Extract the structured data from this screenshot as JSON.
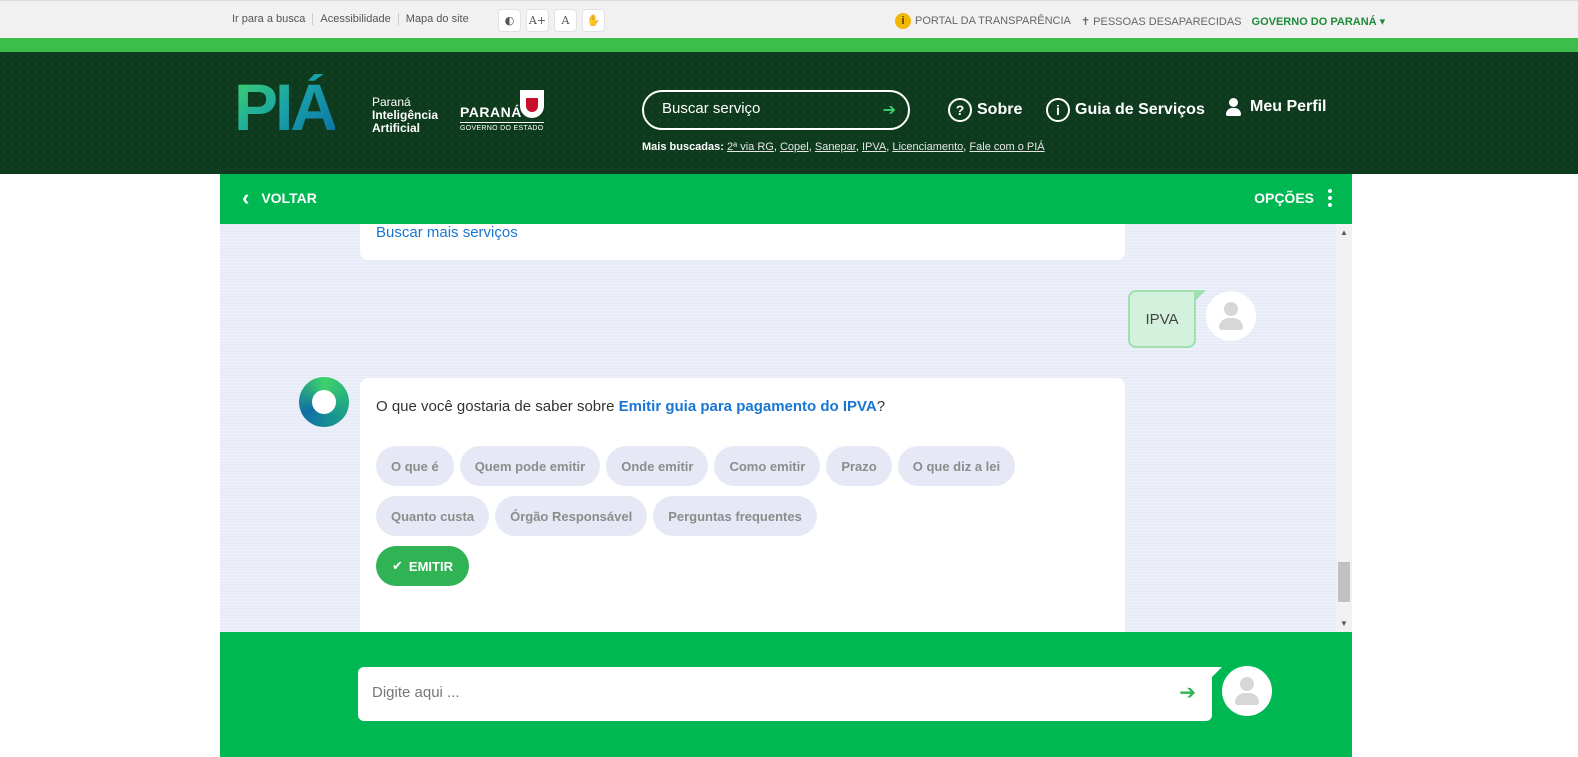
{
  "topbar": {
    "links": [
      "Ir para a busca",
      "Acessibilidade",
      "Mapa do site"
    ],
    "a11y_buttons": [
      "◐",
      "A+",
      "A",
      "✋"
    ],
    "portal": "PORTAL DA TRANSPARÊNCIA",
    "pessoas": "PESSOAS DESAPARECIDAS",
    "governo": "GOVERNO DO PARANÁ"
  },
  "header": {
    "logo": "PIÁ",
    "tagline": [
      "Paraná",
      "Inteligência",
      "Artificial"
    ],
    "state": "PARANÁ",
    "state_sub": "GOVERNO DO ESTADO",
    "search_placeholder": "Buscar serviço",
    "mais_label": "Mais buscadas:",
    "mais_links": [
      "2ª via RG",
      "Copel",
      "Sanepar",
      "IPVA",
      "Licenciamento",
      "Fale com o PIÁ"
    ],
    "nav": {
      "sobre": "Sobre",
      "guia": "Guia de Serviços",
      "perfil": "Meu Perfil"
    }
  },
  "chatbar": {
    "voltar": "VOLTAR",
    "opcoes": "OPÇÕES"
  },
  "chat": {
    "prev_link": "Buscar mais serviços",
    "user_message": "IPVA",
    "question_prefix": "O que você gostaria de saber sobre ",
    "question_highlight": "Emitir guia para pagamento do IPVA",
    "question_suffix": "?",
    "chips": [
      "O que é",
      "Quem pode emitir",
      "Onde emitir",
      "Como emitir",
      "Prazo",
      "O que diz a lei",
      "Quanto custa",
      "Órgão Responsável",
      "Perguntas frequentes"
    ],
    "emitir": "EMITIR"
  },
  "input": {
    "placeholder": "Digite aqui ..."
  },
  "colors": {
    "brand_green": "#00b851",
    "header_dark": "#0e3a1e",
    "link_blue": "#1976d2"
  }
}
